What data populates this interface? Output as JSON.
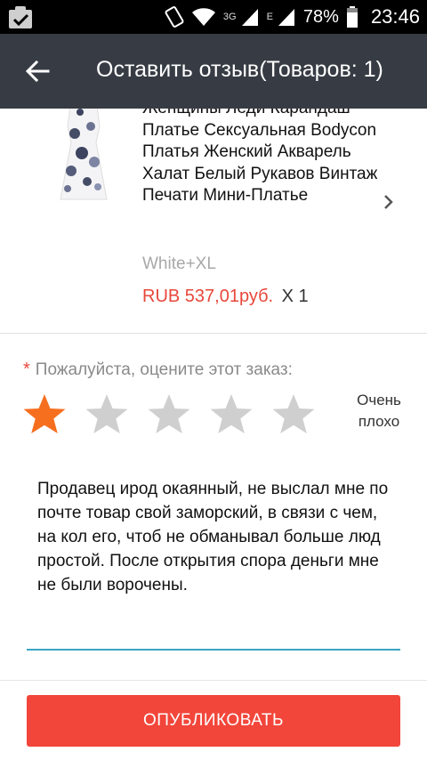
{
  "status_bar": {
    "network_label": "3G",
    "network_label_2": "E",
    "battery_percent": "78%",
    "time": "23:46",
    "icons": [
      "clipboard-check-icon",
      "phone-vibrate-icon",
      "wifi-icon",
      "signal-icon",
      "signal-icon",
      "battery-icon"
    ]
  },
  "appbar": {
    "title": "Оставить отзыв(Товаров: 1)",
    "back_icon": "arrow-back-icon"
  },
  "product": {
    "title": "Женщины Леди Карандаш Платье Сексуальная Bodycon Платья Женский Акварель Халат Белый Рукавов Винтаж Печати Мини-Платье",
    "variant": "White+XL",
    "price": "RUB 537,01руб.",
    "quantity": "X 1",
    "image_icon": "dress-image"
  },
  "rating": {
    "required_mark": "*",
    "prompt": "Пожалуйста, оцените этот заказ:",
    "value": 1,
    "max": 5,
    "label": "Очень плохо",
    "active_color": "#f66f1f",
    "inactive_color": "#cfcfcf"
  },
  "review": {
    "text": "Продавец ирод окаянный, не выслал мне по почте товар свой заморский, в связи с чем, на кол его, чтоб не обманывал больше люд простой. После открытия спора деньги мне не были ворочены."
  },
  "publish_button": {
    "label": "ОПУБЛИКОВАТЬ",
    "color": "#f2463b"
  }
}
